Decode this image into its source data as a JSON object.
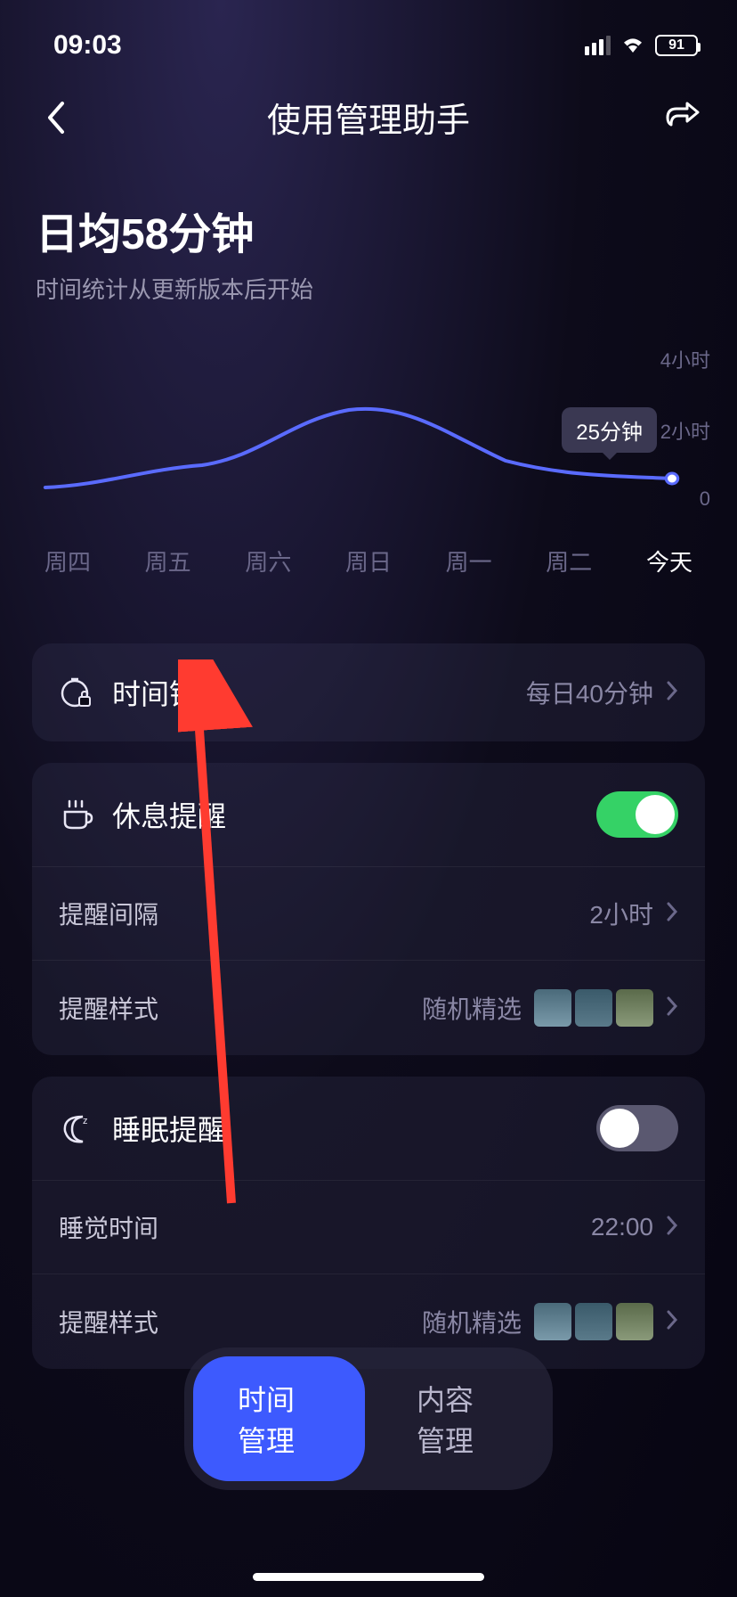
{
  "status_bar": {
    "time": "09:03",
    "battery": "91"
  },
  "header": {
    "title": "使用管理助手"
  },
  "summary": {
    "title": "日均58分钟",
    "subtitle": "时间统计从更新版本后开始"
  },
  "chart_data": {
    "type": "line",
    "categories": [
      "周四",
      "周五",
      "周六",
      "周日",
      "周一",
      "周二",
      "今天"
    ],
    "values": [
      30,
      48,
      95,
      120,
      80,
      50,
      25
    ],
    "ylabel": "",
    "ylim": [
      0,
      240
    ],
    "y_ticks": [
      "4小时",
      "2小时",
      "0"
    ],
    "tooltip": "25分钟",
    "highlighted_category": "今天"
  },
  "cards": {
    "time_lock": {
      "label": "时间锁",
      "value": "每日40分钟"
    },
    "break_reminder": {
      "label": "休息提醒",
      "on": true,
      "interval_label": "提醒间隔",
      "interval_value": "2小时",
      "style_label": "提醒样式",
      "style_value": "随机精选"
    },
    "sleep_reminder": {
      "label": "睡眠提醒",
      "on": false,
      "time_label": "睡觉时间",
      "time_value": "22:00",
      "style_label": "提醒样式",
      "style_value": "随机精选"
    }
  },
  "bottom_tabs": {
    "active": "时间管理",
    "items": [
      "时间管理",
      "内容管理"
    ]
  }
}
